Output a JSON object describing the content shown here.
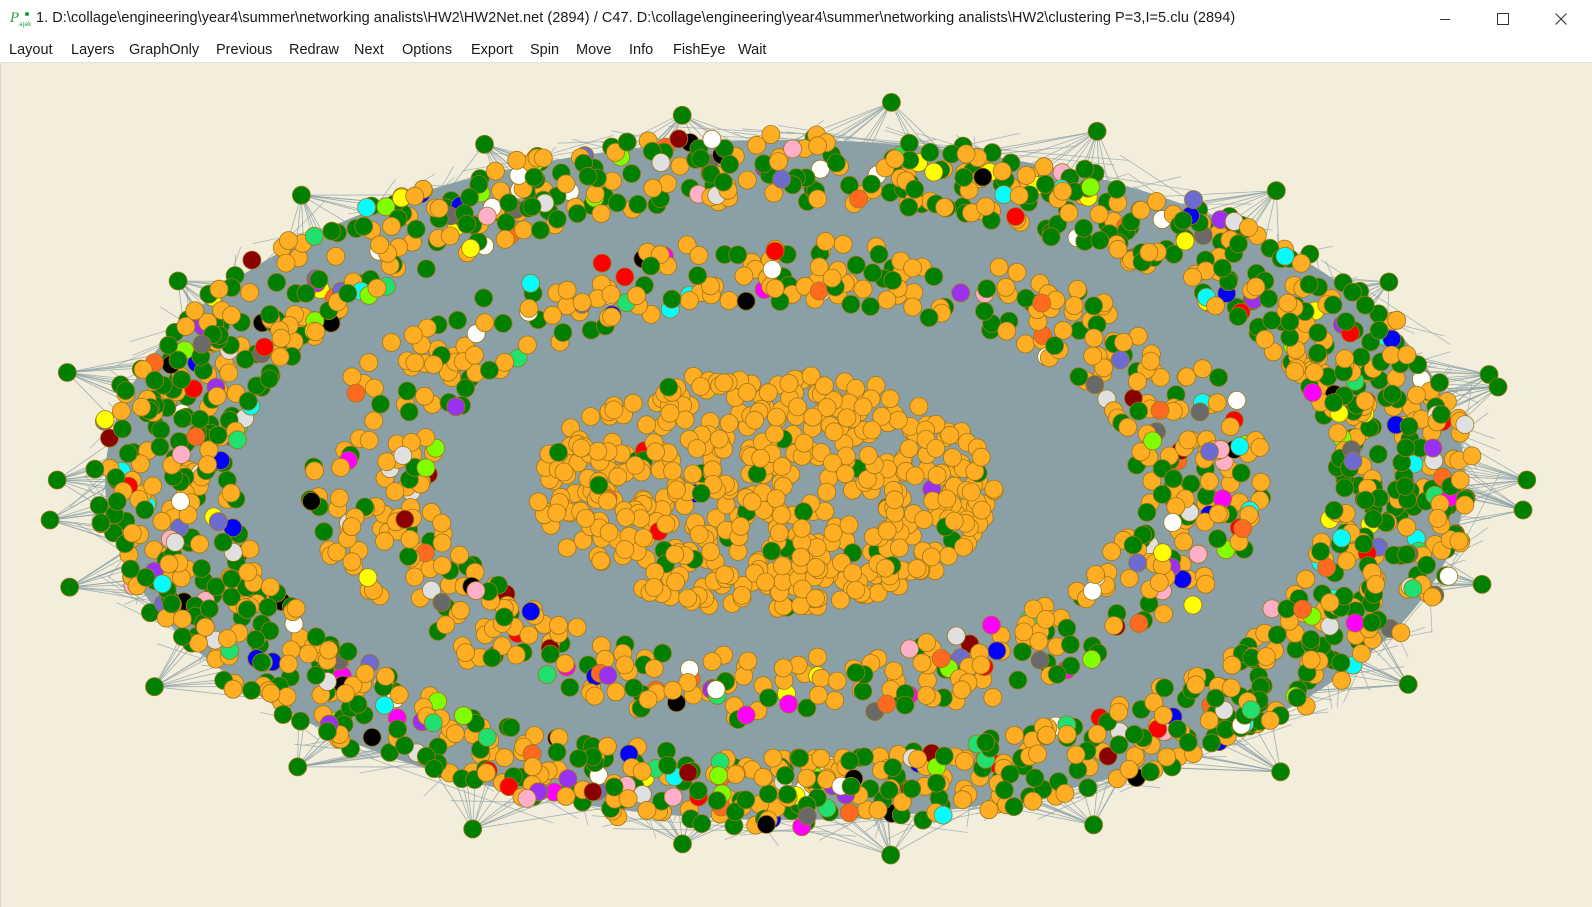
{
  "window": {
    "title": "1. D:\\collage\\engineering\\year4\\summer\\networking analists\\HW2\\HW2Net.net (2894) / C47. D:\\collage\\engineering\\year4\\summer\\networking analists\\HW2\\clustering P=3,I=5.clu (2894)",
    "app_icon": "pajek-logo-icon",
    "controls": [
      "minimize-icon",
      "maximize-icon",
      "close-icon"
    ]
  },
  "menu": {
    "items": [
      {
        "label": "Layout"
      },
      {
        "label": "Layers"
      },
      {
        "label": "GraphOnly"
      },
      {
        "label": "Previous"
      },
      {
        "label": "Redraw"
      },
      {
        "label": "Next"
      },
      {
        "label": "Options"
      },
      {
        "label": "Export"
      },
      {
        "label": "Spin"
      },
      {
        "label": "Move"
      },
      {
        "label": "Info"
      },
      {
        "label": "FishEye"
      },
      {
        "label": "Wait"
      }
    ]
  },
  "network": {
    "vertex_count": 2894,
    "background_color": "#f3eddc",
    "edge_color": "#8aa0a6",
    "vertex_outline_color": "#a07818",
    "cluster_colors": [
      "#ffad22",
      "#008000",
      "#ffffff",
      "#ff00ff",
      "#0000ff",
      "#00ffff",
      "#000000",
      "#ff0000",
      "#9a30f0",
      "#ff6a20",
      "#ffff00",
      "#80ff00",
      "#ffb0c8",
      "#696969",
      "#8b0000",
      "#e0e0e0",
      "#6b6bd0",
      "#20e070"
    ]
  }
}
